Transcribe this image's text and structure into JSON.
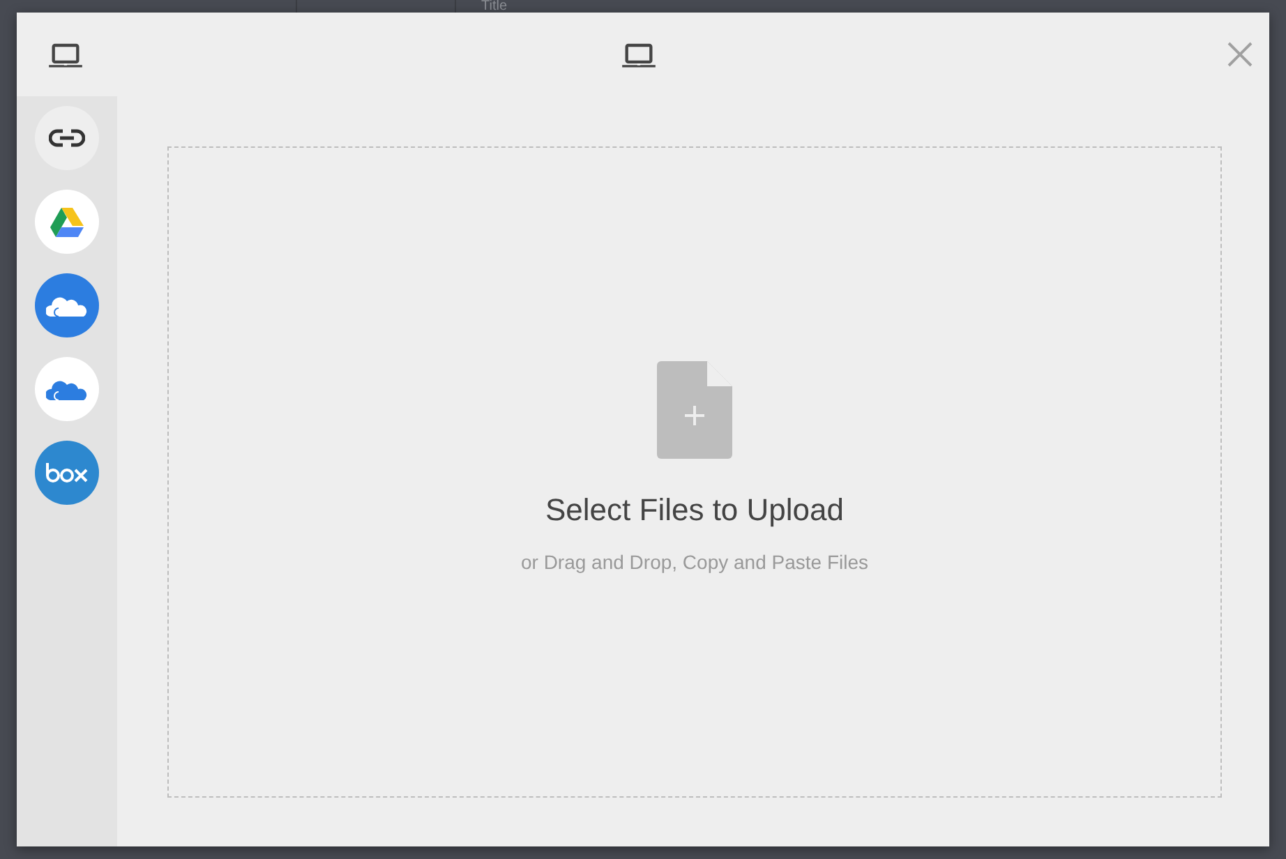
{
  "background": {
    "column_heading": "Title"
  },
  "dialog": {
    "header_icons": [
      {
        "kind": "laptop"
      },
      {
        "kind": "laptop"
      }
    ],
    "sources": [
      {
        "kind": "link"
      },
      {
        "kind": "drive"
      },
      {
        "kind": "onedrive-blue"
      },
      {
        "kind": "onedrive-white"
      },
      {
        "kind": "box"
      }
    ],
    "dropzone": {
      "title": "Select Files to Upload",
      "subtitle": "or Drag and Drop, Copy and Paste Files"
    }
  }
}
